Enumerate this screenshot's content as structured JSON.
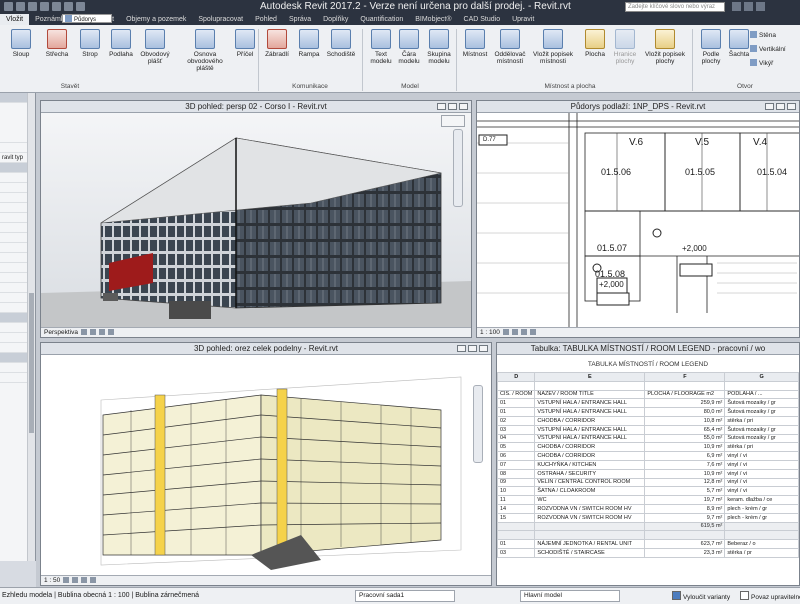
{
  "window": {
    "title": "Autodesk Revit 2017.2 - Verze není určena pro další prodej.  -  Revit.rvt",
    "search_placeholder": "Zadejte klíčové slovo nebo výraz"
  },
  "ribbon_bar": {
    "tabs": [
      "Vložit",
      "Poznámky",
      "Analyzovat",
      "Objemy a pozemek",
      "Spolupracovat",
      "Pohled",
      "Správa",
      "Doplňky",
      "Quantification",
      "BIMobject®",
      "CAD Studio",
      "Upravit"
    ],
    "active": "Vložit"
  },
  "type_selector": "Půdorys",
  "ribbon": {
    "buttons": [
      {
        "label": "Sloup"
      },
      {
        "label": "Střecha"
      },
      {
        "label": "Strop"
      },
      {
        "label": "Podlaha"
      },
      {
        "label": "Obvodový plášť"
      },
      {
        "label": "Osnova obvodového pláště"
      },
      {
        "label": "Příčel"
      },
      {
        "label": "Zábradlí"
      },
      {
        "label": "Rampa"
      },
      {
        "label": "Schodiště"
      },
      {
        "label": "Text modelu"
      },
      {
        "label": "Čára modelu"
      },
      {
        "label": "Skupina modelu"
      },
      {
        "label": "Místnost"
      },
      {
        "label": "Oddělovač místností"
      },
      {
        "label": "Vložit popisek místnosti"
      },
      {
        "label": "Plocha"
      },
      {
        "label": "Hranice plochy"
      },
      {
        "label": "Vložit popisek plochy"
      },
      {
        "label": "Podle plochy"
      },
      {
        "label": "Šachta"
      }
    ],
    "small_buttons": [
      "Stěna",
      "Vertikální",
      "Vikýř"
    ],
    "groups": [
      "Stavět",
      "Komunikace",
      "Model",
      "Místnost a plocha",
      "Otvor"
    ]
  },
  "properties": {
    "rows": [
      "",
      "",
      "",
      "ravit typ",
      "",
      "",
      "",
      "",
      "",
      "",
      "",
      "",
      "",
      "",
      "",
      "",
      "",
      "",
      "",
      "",
      "",
      "",
      "",
      "",
      "",
      ""
    ]
  },
  "views": {
    "persp": {
      "title": "3D pohled: persp 02 - Corso I - Revit.rvt",
      "bar": "Perspektiva"
    },
    "plan": {
      "title": "Půdorys podlaží: 1NP_DPS - Revit.rvt",
      "bar": "1 : 100",
      "rooms": [
        {
          "name": "V.6"
        },
        {
          "name": "V.5"
        },
        {
          "name": "V.4"
        },
        {
          "name": "01.5.06"
        },
        {
          "name": "01.5.05"
        },
        {
          "name": "01.5.04"
        },
        {
          "name": "01.5.07"
        },
        {
          "name": "01.5.08"
        },
        {
          "name": "+2,000"
        },
        {
          "name": "+2,000"
        }
      ],
      "tags": [
        "D.77"
      ]
    },
    "section": {
      "title": "3D pohled: orez celek podelny - Revit.rvt",
      "bar": "1 : 50"
    },
    "schedule": {
      "title": "Tabulka: TABULKA MÍSTNOSTÍ / ROOM LEGEND - pracovní / wo",
      "table_title": "TABULKA MÍSTNOSTÍ / ROOM LEGEND",
      "col_letters": [
        "D",
        "E",
        "F",
        "G"
      ],
      "col_headers": [
        "ČÍS. / ROOM",
        "NÁZEV / ROOM TITLE",
        "PLOCHA / FLOORAGE m2",
        "PODLAHA / ..."
      ],
      "rows": [
        {
          "num": "01",
          "name": "VSTUPNÍ HALA / ENTRANCE HALL",
          "area": "259,9 m²",
          "floor": "Šutová mozaiky / gr"
        },
        {
          "num": "01",
          "name": "VSTUPNÍ HALA / ENTRANCE HALL",
          "area": "80,0 m²",
          "floor": "Šutová mozaiky / gr"
        },
        {
          "num": "02",
          "name": "CHODBA / CORRIDOR",
          "area": "10,8 m²",
          "floor": "stěrka / pri"
        },
        {
          "num": "03",
          "name": "VSTUPNÍ HALA / ENTRANCE HALL",
          "area": "65,4 m²",
          "floor": "Šutová mozaiky / gr"
        },
        {
          "num": "04",
          "name": "VSTUPNÍ HALA / ENTRANCE HALL",
          "area": "55,0 m²",
          "floor": "Šutová mozaiky / gr"
        },
        {
          "num": "05",
          "name": "CHODBA / CORRIDOR",
          "area": "10,9 m²",
          "floor": "stěrka / pri"
        },
        {
          "num": "06",
          "name": "CHODBA / CORRIDOR",
          "area": "6,9 m²",
          "floor": "vinyl / vi"
        },
        {
          "num": "07",
          "name": "KUCHYŇKA / KITCHEN",
          "area": "7,6 m²",
          "floor": "vinyl / vi"
        },
        {
          "num": "08",
          "name": "OSTRAHA / SECURITY",
          "area": "10,9 m²",
          "floor": "vinyl / vi"
        },
        {
          "num": "09",
          "name": "VELÍN / CENTRAL CONTROL ROOM",
          "area": "12,8 m²",
          "floor": "vinyl / vi"
        },
        {
          "num": "10",
          "name": "ŠATNA / CLOAKROOM",
          "area": "5,7 m²",
          "floor": "vinyl / vi"
        },
        {
          "num": "11",
          "name": "WC",
          "area": "19,7 m²",
          "floor": "keram. dlažba / ce"
        },
        {
          "num": "14",
          "name": "ROZVODNA VN / SWITCH ROOM HV",
          "area": "8,9 m²",
          "floor": "plech - krém / gr"
        },
        {
          "num": "15",
          "name": "ROZVODNA VN / SWITCH ROOM HV",
          "area": "9,7 m²",
          "floor": "plech - krém / gr"
        },
        {
          "num": "",
          "name": "",
          "area": "619,5 m²",
          "floor": ""
        },
        {
          "num": "",
          "name": "",
          "area": "",
          "floor": ""
        },
        {
          "num": "01",
          "name": "NÁJEMNÍ JEDNOTKA / RENTAL UNIT",
          "area": "623,7 m²",
          "floor": "Beberaz / o"
        },
        {
          "num": "03",
          "name": "SCHODIŠTĚ / STAIRCASE",
          "area": "23,3 m²",
          "floor": "stěrka / pr"
        }
      ]
    }
  },
  "status": {
    "message": "Ezhledu modela | Bublina obecná 1 : 100 | Bublina zárnečmená",
    "workset": "Pracovní sada1",
    "main_model": "Hlavní model",
    "check_variants": "Vyloučit varianty",
    "check_edit": "Povaz upravitelné"
  }
}
